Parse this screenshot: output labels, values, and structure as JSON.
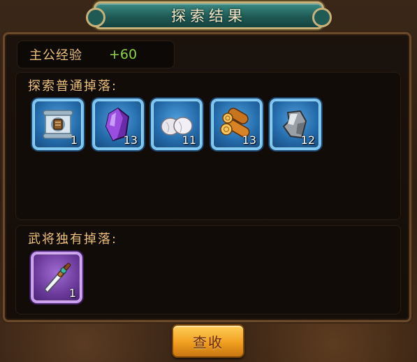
{
  "window": {
    "title": "探索结果"
  },
  "exp": {
    "label": "主公经验",
    "value": "+60"
  },
  "common_drops": {
    "title": "探索普通掉落:",
    "items": [
      {
        "icon": "scroll-icon",
        "count": "1",
        "rarity": "blue"
      },
      {
        "icon": "purple-crystal-icon",
        "count": "13",
        "rarity": "blue"
      },
      {
        "icon": "cotton-icon",
        "count": "11",
        "rarity": "blue"
      },
      {
        "icon": "wood-logs-icon",
        "count": "13",
        "rarity": "blue"
      },
      {
        "icon": "iron-ore-icon",
        "count": "12",
        "rarity": "blue"
      }
    ]
  },
  "hero_drops": {
    "title": "武将独有掉落:",
    "items": [
      {
        "icon": "sword-icon",
        "count": "1",
        "rarity": "purple"
      }
    ]
  },
  "confirm_button": {
    "label": "查收"
  },
  "colors": {
    "title_banner": "#1f5a55",
    "exp_value": "#8ed63f",
    "label_gold": "#f1c47a",
    "button": "#f0a020"
  }
}
